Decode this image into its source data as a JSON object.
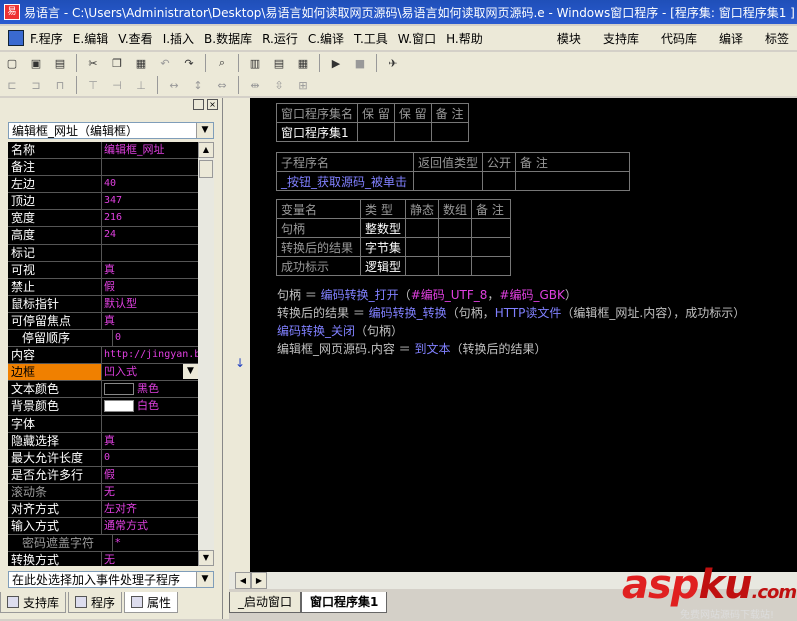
{
  "titlebar": {
    "icon_label": "易",
    "title": "易语言 - C:\\Users\\Administrator\\Desktop\\易语言如何读取网页源码\\易语言如何读取网页源码.e - Windows窗口程序 - [程序集: 窗口程序集1 ]"
  },
  "menu": {
    "items": [
      "F.程序",
      "E.编辑",
      "V.查看",
      "I.插入",
      "B.数据库",
      "R.运行",
      "C.编译",
      "T.工具",
      "W.窗口",
      "H.帮助"
    ],
    "right_items": [
      "模块",
      "支持库",
      "代码库",
      "编译",
      "标签"
    ]
  },
  "toolbar1": {
    "icons": [
      "new-icon",
      "open-icon",
      "save-icon",
      "cut-icon",
      "copy-icon",
      "paste-icon",
      "undo-icon",
      "redo-icon",
      "find-icon",
      "layout1-icon",
      "layout2-icon",
      "layout3-icon",
      "run-icon",
      "stop-icon",
      "debug-icon"
    ]
  },
  "left_panel": {
    "object_selector": "编辑框_网址（编辑框）",
    "event_selector": "在此处选择加入事件处理子程序",
    "properties": [
      {
        "name": "名称",
        "value": "编辑框_网址"
      },
      {
        "name": "备注",
        "value": ""
      },
      {
        "name": "左边",
        "value": "40"
      },
      {
        "name": "顶边",
        "value": "347"
      },
      {
        "name": "宽度",
        "value": "216"
      },
      {
        "name": "高度",
        "value": "24"
      },
      {
        "name": "标记",
        "value": ""
      },
      {
        "name": "可视",
        "value": "真"
      },
      {
        "name": "禁止",
        "value": "假"
      },
      {
        "name": "鼠标指针",
        "value": "默认型"
      },
      {
        "name": "可停留焦点",
        "value": "真"
      },
      {
        "name": "停留顺序",
        "value": "0"
      },
      {
        "name": "内容",
        "value": "http://jingyan.b"
      },
      {
        "name": "边框",
        "value": "凹入式"
      },
      {
        "name": "文本颜色",
        "value": "黑色"
      },
      {
        "name": "背景颜色",
        "value": "白色"
      },
      {
        "name": "字体",
        "value": ""
      },
      {
        "name": "隐藏选择",
        "value": "真"
      },
      {
        "name": "最大允许长度",
        "value": "0"
      },
      {
        "name": "是否允许多行",
        "value": "假"
      },
      {
        "name": "滚动条",
        "value": "无"
      },
      {
        "name": "对齐方式",
        "value": "左对齐"
      },
      {
        "name": "输入方式",
        "value": "通常方式"
      },
      {
        "name": "密码遮盖字符",
        "value": "*"
      },
      {
        "name": "转换方式",
        "value": "无"
      }
    ],
    "swatch_colors": {
      "text": "#000000",
      "background": "#ffffff"
    },
    "tabs": [
      "支持库",
      "程序",
      "属性"
    ]
  },
  "editor": {
    "assembly_table": {
      "headers": [
        "窗口程序集名",
        "保 留",
        "保 留",
        "备 注"
      ],
      "row": [
        "窗口程序集1",
        "",
        "",
        ""
      ]
    },
    "sub_table": {
      "headers": [
        "子程序名",
        "返回值类型",
        "公开",
        "备 注"
      ],
      "row": [
        "_按钮_获取源码_被单击",
        "",
        "",
        ""
      ]
    },
    "var_table": {
      "headers": [
        "变量名",
        "类 型",
        "静态",
        "数组",
        "备 注"
      ],
      "rows": [
        [
          "句柄",
          "整数型",
          "",
          "",
          ""
        ],
        [
          "转换后的结果",
          "字节集",
          "",
          "",
          ""
        ],
        [
          "成功标示",
          "逻辑型",
          "",
          "",
          ""
        ]
      ]
    },
    "code_lines": {
      "l1": {
        "a": "句柄",
        "b": " ＝ ",
        "c": "编码转换_打开",
        "d": "（",
        "e": "#编码_UTF_8",
        "f": "，",
        "g": "#编码_GBK",
        "h": "）"
      },
      "l2": {
        "a": "转换后的结果",
        "b": " ＝ ",
        "c": "编码转换_转换",
        "d": "（句柄，",
        "e": "HTTP读文件",
        "f": "（编辑框_网址.内容），成功标示）"
      },
      "l3": {
        "a": "编码转换_关闭",
        "b": "（句柄）"
      },
      "l4": {
        "a": "编辑框_网页源码.内容",
        "b": " ＝ ",
        "c": "到文本",
        "d": "（转换后的结果）"
      }
    },
    "tabs": [
      "_启动窗口",
      "窗口程序集1"
    ]
  },
  "watermark": {
    "brand_a": "asp",
    "brand_b": "ku",
    "suffix": ".com",
    "tagline": "免费网站源码下载站!"
  }
}
